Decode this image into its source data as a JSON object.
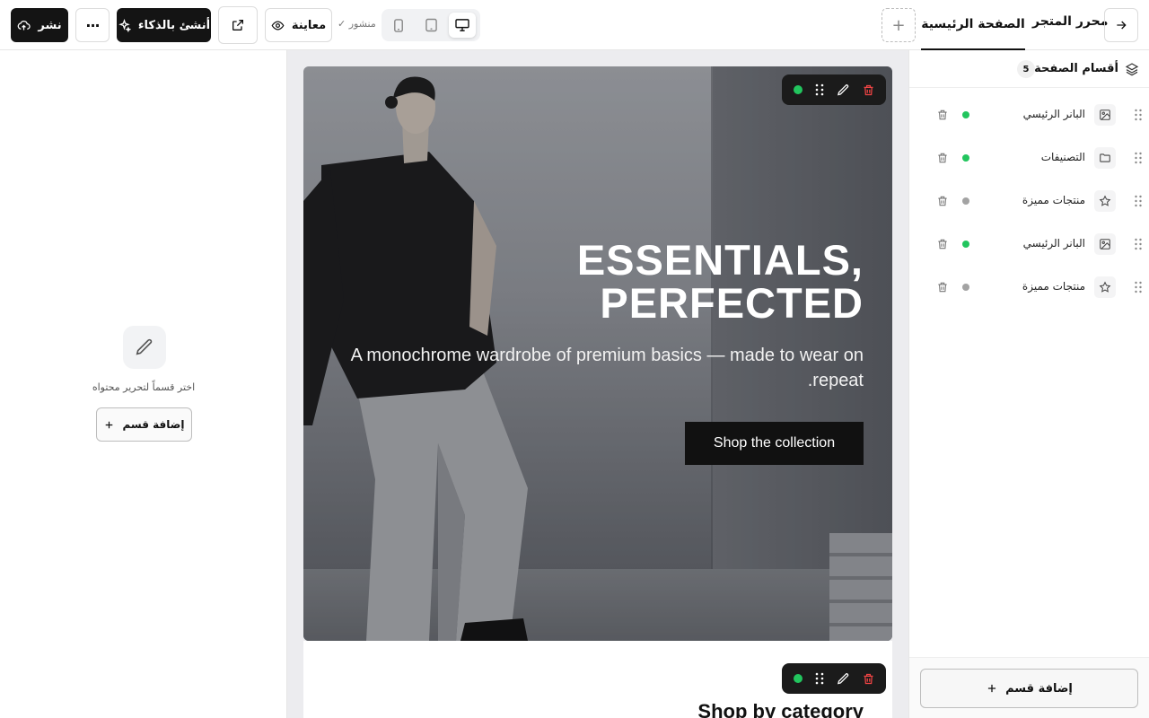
{
  "topbar": {
    "publish_label": "نشر",
    "more_label": "···",
    "ai_label": "أنشئ بالذكاء",
    "preview_label": "معاينة",
    "published_status": "✓ منشور",
    "add_page_label": "+",
    "page_tab_label": "الصفحة الرئيسية",
    "editor_title": "محرر المتجر"
  },
  "left_panel": {
    "empty_text": "اختر قسماً لتحرير محتواه",
    "add_section_label": "إضافة قسم"
  },
  "canvas": {
    "hero": {
      "title_line1": "ESSENTIALS,",
      "title_line2": "PERFECTED",
      "subtitle": "A monochrome wardrobe of premium basics — made to wear on repeat.",
      "cta_label": "Shop the collection"
    },
    "category_section": {
      "title": "Shop by category"
    }
  },
  "sections_panel": {
    "title": "أقسام الصفحة",
    "count": "5",
    "items": [
      {
        "label": "البانر الرئيسي",
        "icon": "image-icon",
        "status": "active"
      },
      {
        "label": "التصنيفات",
        "icon": "folder-icon",
        "status": "active"
      },
      {
        "label": "منتجات مميزة",
        "icon": "star-icon",
        "status": "inactive"
      },
      {
        "label": "البانر الرئيسي",
        "icon": "image-icon",
        "status": "active"
      },
      {
        "label": "منتجات مميزة",
        "icon": "star-icon",
        "status": "inactive"
      }
    ],
    "add_section_label": "إضافة قسم"
  },
  "colors": {
    "primary": "#141414",
    "active_dot": "#22c55e",
    "inactive_dot": "#a3a3a3",
    "delete_red": "#ef4444"
  }
}
